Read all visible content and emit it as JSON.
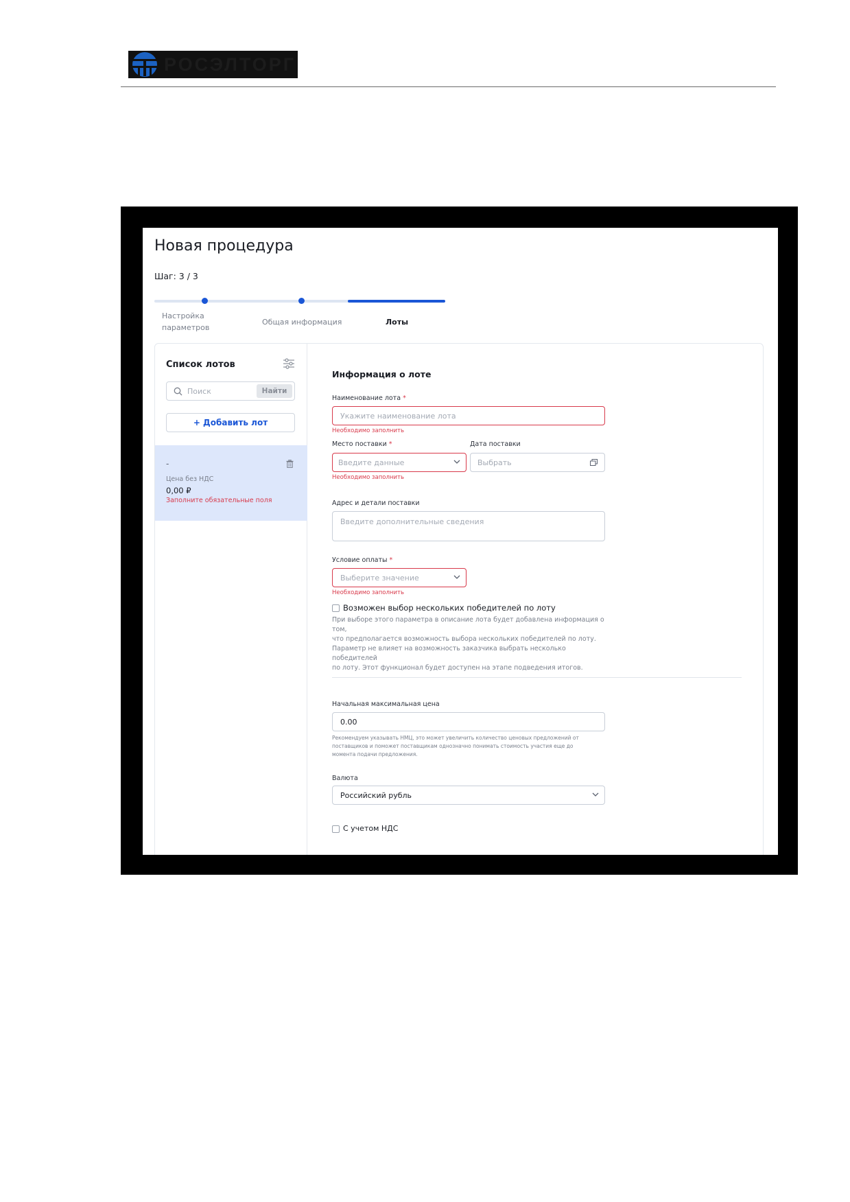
{
  "document": {
    "logo_text": "РОСЭЛТОРГ"
  },
  "app": {
    "page_title": "Новая процедура",
    "step": "Шаг: 3 / 3",
    "stepper": {
      "steps": [
        {
          "line1": "Настройка",
          "line2": "параметров",
          "state": "done"
        },
        {
          "line1": "Общая информация",
          "line2": "",
          "state": "done"
        },
        {
          "line1": "Лоты",
          "line2": "",
          "state": "active"
        }
      ],
      "progress": 1.0,
      "accent_color": "#1a56d6"
    },
    "sidebar": {
      "title": "Список лотов",
      "filter_icon": "filter-sliders-icon",
      "search": {
        "placeholder": "Поиск",
        "button": "Найти"
      },
      "add_lot_button": "+ Добавить лот",
      "lots": [
        {
          "name": "-",
          "price_label": "Цена без НДС",
          "price": "0,00 ₽",
          "error": "Заполните обязательные поля"
        }
      ]
    },
    "form": {
      "section_title": "Информация о лоте",
      "lot_name": {
        "label": "Наименование лота",
        "required_mark": "*",
        "placeholder": "Укажите наименование лота",
        "error": "Необходимо заполнить"
      },
      "delivery_place": {
        "label": "Место поставки",
        "required_mark": "*",
        "placeholder": "Введите данные",
        "error": "Необходимо заполнить"
      },
      "delivery_date": {
        "label": "Дата поставки",
        "placeholder": "Выбрать"
      },
      "address": {
        "label": "Адрес и детали поставки",
        "placeholder": "Введите дополнительные сведения"
      },
      "payment_condition": {
        "label": "Условие оплаты",
        "required_mark": "*",
        "placeholder": "Выберите значение",
        "error": "Необходимо заполнить"
      },
      "multiple_winners": {
        "label": "Возможен выбор нескольких победителей по лоту",
        "checked": false,
        "hint_lines": [
          "При выборе этого параметра в описание лота будет добавлена информация о том,",
          "что предполагается возможность выбора нескольких победителей по лоту.",
          "Параметр не влияет на возможность заказчика выбрать несколько победителей",
          "по лоту. Этот функционал будет доступен на этапе подведения итогов."
        ]
      },
      "max_price": {
        "label": "Начальная максимальная цена",
        "value": "0.00",
        "hint_lines": [
          "Рекомендуем указывать НМЦ, это может увеличить количество ценовых предложений от",
          "поставщиков и поможет поставщикам однозначно понимать стоимость участия еще до",
          "момента подачи предложения."
        ]
      },
      "currency": {
        "label": "Валюта",
        "value": "Российский рубль"
      },
      "vat": {
        "label": "С учетом НДС",
        "checked": false
      }
    },
    "colors": {
      "error": "#d8394a",
      "selected_lot_bg": "#dde7fb",
      "accent": "#1a56d6"
    }
  }
}
